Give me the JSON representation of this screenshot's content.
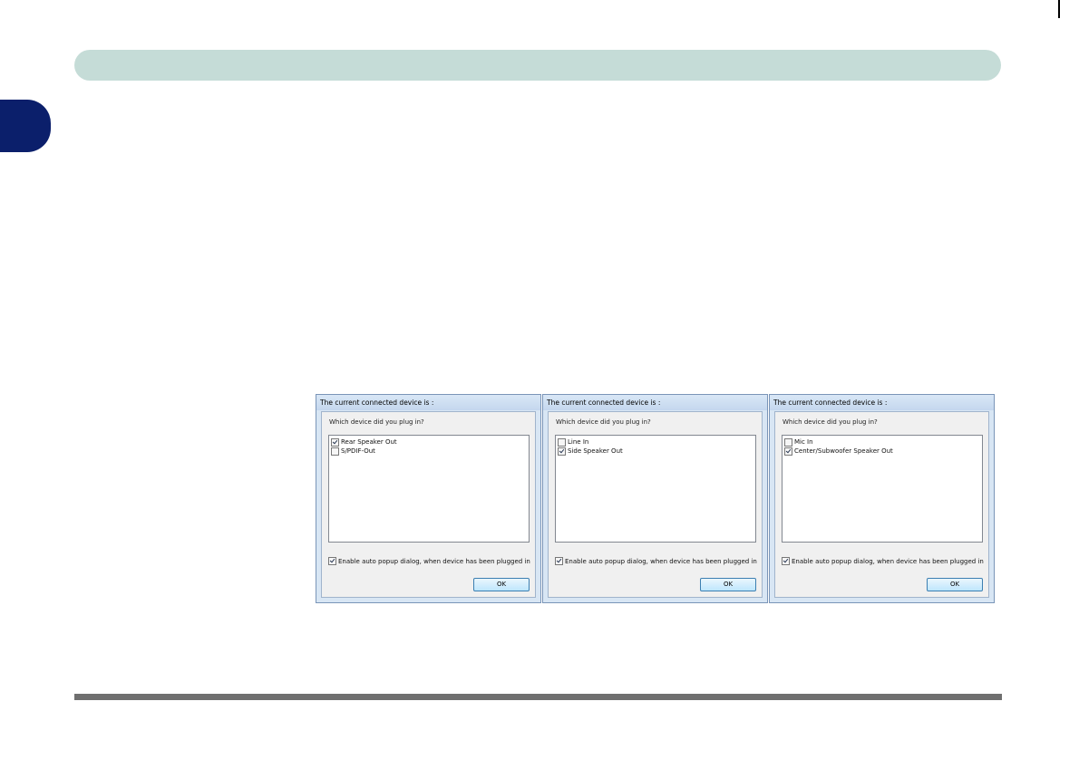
{
  "dialogs": [
    {
      "title": "The current connected device is :",
      "prompt": "Which device did you plug in?",
      "options": [
        {
          "label": "Rear Speaker Out",
          "checked": true
        },
        {
          "label": "S/PDIF-Out",
          "checked": false
        }
      ],
      "auto_popup_label": "Enable auto popup dialog, when device has been plugged in",
      "auto_popup_checked": true,
      "ok_label": "OK"
    },
    {
      "title": "The current connected device is :",
      "prompt": "Which device did you plug in?",
      "options": [
        {
          "label": "Line In",
          "checked": false
        },
        {
          "label": "Side Speaker Out",
          "checked": true
        }
      ],
      "auto_popup_label": "Enable auto popup dialog, when device has been plugged in",
      "auto_popup_checked": true,
      "ok_label": "OK"
    },
    {
      "title": "The current connected device is :",
      "prompt": "Which device did you plug in?",
      "options": [
        {
          "label": "Mic In",
          "checked": false
        },
        {
          "label": "Center/Subwoofer Speaker Out",
          "checked": true
        }
      ],
      "auto_popup_label": "Enable auto popup dialog, when device has been plugged in",
      "auto_popup_checked": true,
      "ok_label": "OK"
    }
  ],
  "colors": {
    "header_bar": "#c5dcd7",
    "chapter_tab": "#0b1f6b",
    "footer_rule": "#6f6f6f"
  }
}
